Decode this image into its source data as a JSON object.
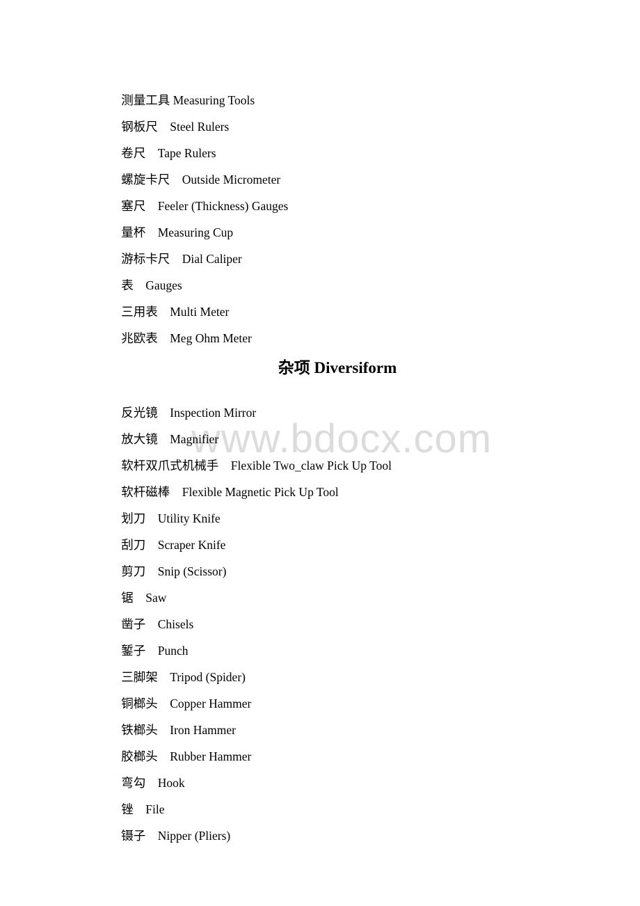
{
  "watermark": "www.bdocx.com",
  "section1": {
    "title_line": {
      "zh": "测量工具",
      "en": "Measuring Tools"
    },
    "items": [
      {
        "zh": "钢板尺",
        "en": "Steel Rulers"
      },
      {
        "zh": "卷尺",
        "en": "Tape Rulers"
      },
      {
        "zh": "螺旋卡尺",
        "en": "Outside Micrometer"
      },
      {
        "zh": "塞尺",
        "en": "Feeler (Thickness) Gauges"
      },
      {
        "zh": "量杯",
        "en": "Measuring Cup"
      },
      {
        "zh": "游标卡尺",
        "en": "Dial Caliper"
      },
      {
        "zh": "表",
        "en": "Gauges"
      },
      {
        "zh": "三用表",
        "en": "Multi Meter"
      },
      {
        "zh": "兆欧表",
        "en": "Meg Ohm Meter"
      }
    ]
  },
  "section2": {
    "heading": "杂项 Diversiform",
    "items": [
      {
        "zh": "反光镜",
        "en": "Inspection Mirror"
      },
      {
        "zh": "放大镜",
        "en": "Magnifier"
      },
      {
        "zh": "软杆双爪式机械手",
        "en": "Flexible Two_claw Pick Up Tool"
      },
      {
        "zh": "软杆磁棒",
        "en": "Flexible Magnetic Pick Up Tool"
      },
      {
        "zh": "划刀",
        "en": "Utility Knife"
      },
      {
        "zh": "刮刀",
        "en": "Scraper Knife"
      },
      {
        "zh": "剪刀",
        "en": "Snip (Scissor)"
      },
      {
        "zh": "锯",
        "en": "Saw"
      },
      {
        "zh": "凿子",
        "en": "Chisels"
      },
      {
        "zh": "錾子",
        "en": "Punch"
      },
      {
        "zh": "三脚架",
        "en": "Tripod (Spider)"
      },
      {
        "zh": "铜榔头",
        "en": "Copper Hammer"
      },
      {
        "zh": "铁榔头",
        "en": "Iron Hammer"
      },
      {
        "zh": "胶榔头",
        "en": "Rubber Hammer"
      },
      {
        "zh": "弯勾",
        "en": "Hook"
      },
      {
        "zh": "锉",
        "en": "File"
      },
      {
        "zh": "镊子",
        "en": "Nipper (Pliers)"
      }
    ]
  }
}
